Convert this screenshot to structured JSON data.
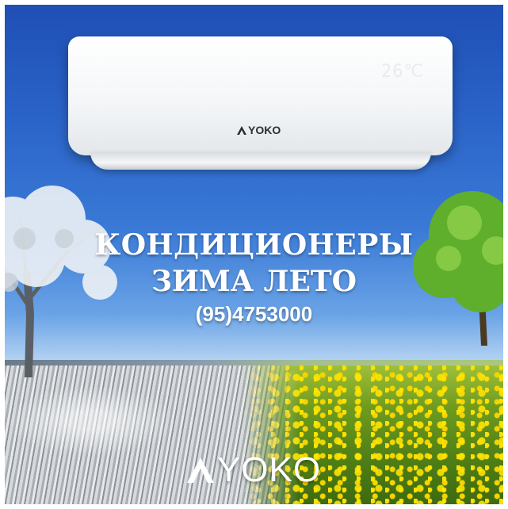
{
  "ad": {
    "headline_line1": "КОНДИЦИОНЕРЫ",
    "headline_line2": "ЗИМА ЛЕТО",
    "phone": "(95)4753000"
  },
  "ac_unit": {
    "brand": "YOKO",
    "display_text": "26℃"
  },
  "bottom_logo": {
    "brand": "YOKO"
  }
}
